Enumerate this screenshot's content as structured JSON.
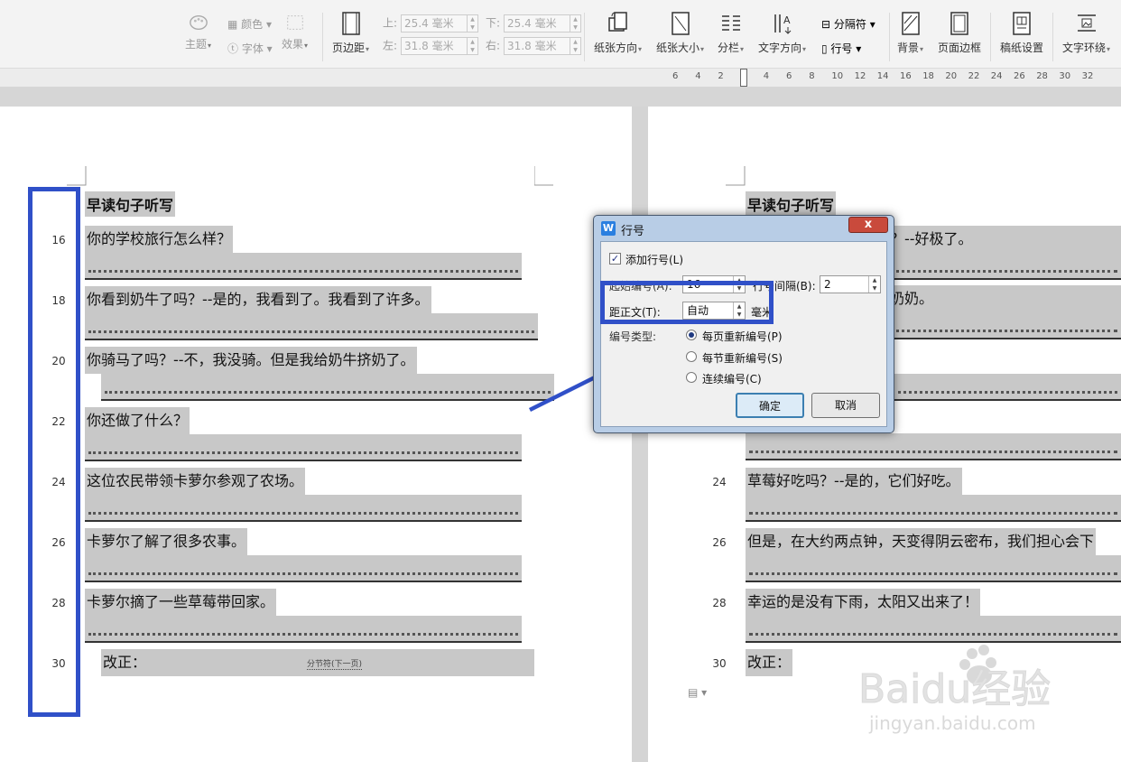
{
  "ribbon": {
    "theme": "主题",
    "color": "颜色",
    "font": "字体",
    "effect": "效果",
    "margins": "页边距",
    "top_label": "上:",
    "top_value": "25.4 毫米",
    "bottom_label": "下:",
    "bottom_value": "25.4 毫米",
    "left_label": "左:",
    "left_value": "31.8 毫米",
    "right_label": "右:",
    "right_value": "31.8 毫米",
    "orientation": "纸张方向",
    "size": "纸张大小",
    "columns": "分栏",
    "text_direction": "文字方向",
    "separator": "分隔符",
    "line_numbers": "行号",
    "background": "背景",
    "page_border": "页面边框",
    "grid_paper": "稿纸设置",
    "text_wrap": "文字环绕"
  },
  "ruler": {
    "ticks": [
      "6",
      "4",
      "2",
      "2",
      "4",
      "6",
      "8",
      "10",
      "12",
      "14",
      "16",
      "18",
      "20",
      "22",
      "24",
      "26",
      "28",
      "30",
      "32"
    ]
  },
  "left_page": {
    "title": "早读句子听写",
    "lines": [
      {
        "num": "16",
        "text": "你的学校旅行怎么样？"
      },
      {
        "num": "18",
        "text": "你看到奶牛了吗？--是的，我看到了。我看到了许多。"
      },
      {
        "num": "20",
        "text": "你骑马了吗？--不，我没骑。但是我给奶牛挤奶了。"
      },
      {
        "num": "22",
        "text": "你还做了什么？"
      },
      {
        "num": "24",
        "text": "这位农民带领卡萝尔参观了农场。"
      },
      {
        "num": "26",
        "text": "卡萝尔了解了很多农事。"
      },
      {
        "num": "28",
        "text": "卡萝尔摘了一些草莓带回家。"
      },
      {
        "num": "30",
        "text": "改正："
      }
    ],
    "section_break": "分节符(下一页)"
  },
  "right_page": {
    "title": "早读句子听写",
    "line1_tail": "？--好极了。",
    "line2_tail": "奶奶。",
    "lines": [
      {
        "num": "24",
        "text": "草莓好吃吗？--是的，它们好吃。"
      },
      {
        "num": "26",
        "text": "但是，在大约两点钟，天变得阴云密布，我们担心会下"
      },
      {
        "num": "28",
        "text": "幸运的是没有下雨，太阳又出来了！"
      },
      {
        "num": "30",
        "text": "改正："
      }
    ]
  },
  "dialog": {
    "title": "行号",
    "close": "x",
    "add_line_numbers": "添加行号(L)",
    "start_at_label": "起始编号(A):",
    "start_at_value": "16",
    "count_by_label": "行号间隔(B):",
    "count_by_value": "2",
    "from_text_label": "距正文(T):",
    "from_text_value": "自动",
    "from_text_unit": "毫米",
    "numbering_label": "编号类型:",
    "restart_page": "每页重新编号(P)",
    "restart_section": "每节重新编号(S)",
    "continuous": "连续编号(C)",
    "ok": "确定",
    "cancel": "取消"
  },
  "watermark": {
    "brand": "Baidu经验",
    "url": "jingyan.baidu.com"
  },
  "colors": {
    "highlight": "#3050c8",
    "text_shading": "#c8c8c8"
  }
}
